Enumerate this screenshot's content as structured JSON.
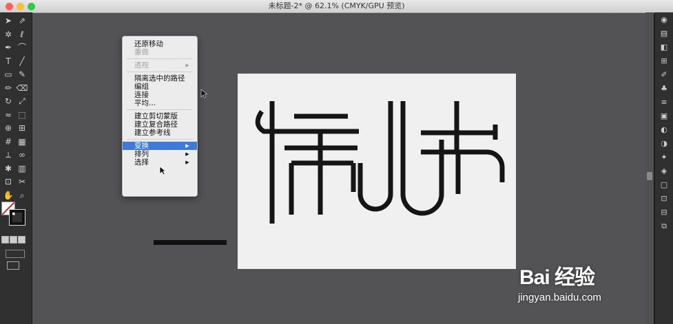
{
  "window": {
    "title": "未标题-2* @ 62.1% (CMYK/GPU 预览)",
    "traffic_lights": {
      "close": "#fc605b",
      "minimize": "#fdbc40",
      "zoom": "#34c84a"
    }
  },
  "toolbar": {
    "tools": [
      "selection-tool-icon",
      "direct-selection-tool-icon",
      "magic-wand-icon",
      "lasso-icon",
      "pen-tool-icon",
      "curvature-icon",
      "type-tool-icon",
      "line-tool-icon",
      "rectangle-tool-icon",
      "paintbrush-icon",
      "pencil-icon",
      "eraser-icon",
      "rotate-icon",
      "scale-icon",
      "width-tool-icon",
      "free-transform-icon",
      "shape-builder-icon",
      "perspective-grid-icon",
      "mesh-icon",
      "gradient-icon",
      "eyedropper-icon",
      "blend-icon",
      "symbol-sprayer-icon",
      "column-graph-icon",
      "artboard-icon",
      "slice-icon",
      "hand-icon",
      "zoom-icon"
    ],
    "fill_color": "#ffffff",
    "stroke_color": "#111111"
  },
  "context_menu": {
    "items": [
      {
        "label": "还原移动",
        "disabled": false,
        "submenu": false,
        "selected": false
      },
      {
        "label": "重做",
        "disabled": true,
        "submenu": false,
        "selected": false
      },
      {
        "separator": true
      },
      {
        "label": "透视",
        "disabled": true,
        "submenu": true,
        "selected": false
      },
      {
        "separator": true
      },
      {
        "label": "隔离选中的路径",
        "disabled": false,
        "submenu": false,
        "selected": false
      },
      {
        "label": "编组",
        "disabled": false,
        "submenu": false,
        "selected": false
      },
      {
        "label": "连接",
        "disabled": false,
        "submenu": false,
        "selected": false
      },
      {
        "label": "平均...",
        "disabled": false,
        "submenu": false,
        "selected": false
      },
      {
        "separator": true
      },
      {
        "label": "建立剪切蒙版",
        "disabled": false,
        "submenu": false,
        "selected": false
      },
      {
        "label": "建立复合路径",
        "disabled": false,
        "submenu": false,
        "selected": false
      },
      {
        "label": "建立参考线",
        "disabled": false,
        "submenu": false,
        "selected": false
      },
      {
        "separator": true
      },
      {
        "label": "变换",
        "disabled": false,
        "submenu": true,
        "selected": true
      },
      {
        "label": "排列",
        "disabled": false,
        "submenu": true,
        "selected": false
      },
      {
        "label": "选择",
        "disabled": false,
        "submenu": true,
        "selected": false
      }
    ]
  },
  "artboard": {
    "artwork_text": "情人节",
    "background": "#f0f0f0",
    "stroke_color": "#151515"
  },
  "right_panel": {
    "icons": [
      "properties-icon",
      "libraries-icon",
      "color-icon",
      "swatches-icon",
      "brushes-icon",
      "symbols-icon",
      "stroke-icon",
      "gradient-panel-icon",
      "transparency-icon",
      "appearance-icon",
      "graphic-styles-icon",
      "layers-icon",
      "artboards-icon",
      "transform-icon",
      "align-icon",
      "pathfinder-icon"
    ]
  },
  "watermark": {
    "brand": "Bai 经验",
    "url": "jingyan.baidu.com"
  },
  "arrow_glyph": "▶"
}
